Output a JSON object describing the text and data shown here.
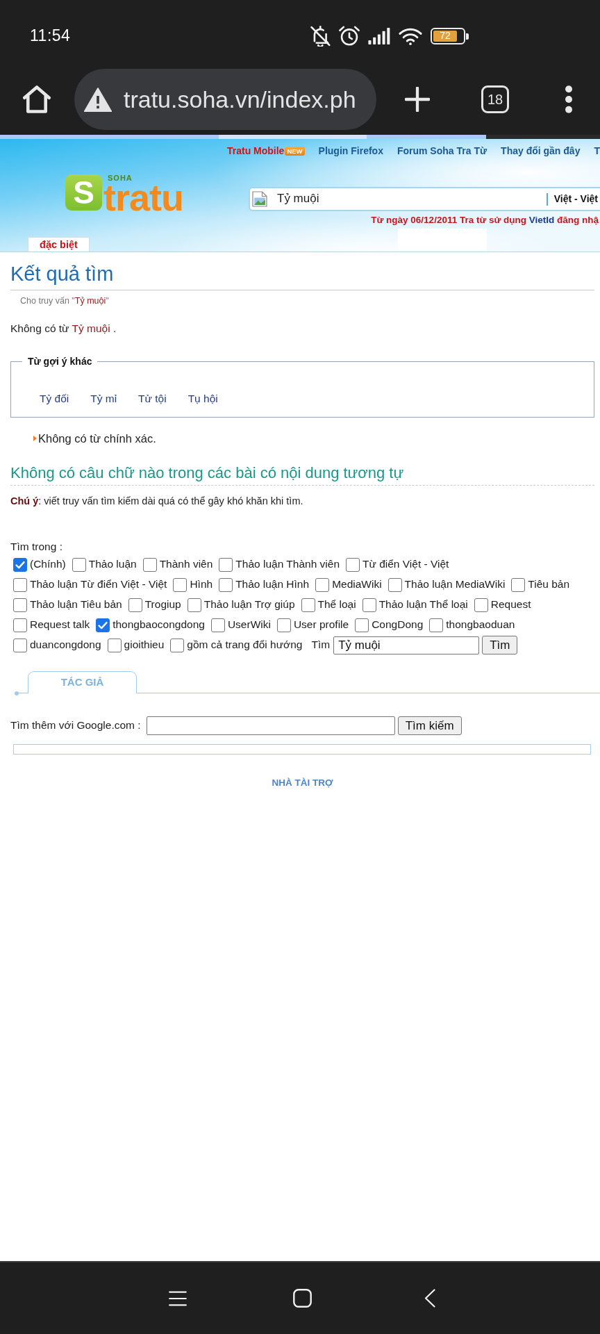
{
  "status_bar": {
    "time": "11:54",
    "battery": "72"
  },
  "browser": {
    "url": "tratu.soha.vn/index.ph",
    "tab_count": "18",
    "progress": {
      "level": 0.81
    }
  },
  "site_header": {
    "top_links": [
      {
        "label": "Tratu Mobile",
        "kind": "featured",
        "badge": "NEW"
      },
      {
        "label": "Plugin Firefox",
        "kind": "plain"
      },
      {
        "label": "Forum Soha Tra Từ",
        "kind": "plain"
      },
      {
        "label": "Thay đổi gần đây",
        "kind": "plain"
      },
      {
        "label": "T",
        "kind": "plain"
      }
    ],
    "logo": {
      "brand": "SOHA",
      "initial": "S",
      "name": "tratu"
    },
    "search": {
      "value": "Tỷ muội",
      "dictionary": "Việt - Việt"
    },
    "notice": {
      "text": "Từ ngày 06/12/2011 Tra từ sử dụng",
      "link": "VietId",
      "after": "đăng nhậ"
    },
    "tabs": [
      {
        "label": "đặc biệt",
        "selected": true
      }
    ]
  },
  "results": {
    "title": "Kết quả tìm",
    "query_line": {
      "prefix": "Cho truy vấn \"",
      "term": "Tỷ muội",
      "suffix": "\""
    },
    "no_match": {
      "prefix": "Không có từ",
      "term": "Tỷ muội",
      "suffix": "."
    },
    "suggestions": {
      "legend": "Từ gợi ý khác",
      "items": [
        "Tỷ đối",
        "Tỷ mỉ",
        "Tử tội",
        "Tụ hội"
      ]
    },
    "exact_note": "Không có từ chính xác.",
    "fulltext_heading": "Không có câu chữ nào trong các bài có nội dung tương tự",
    "tip": "**Chú ý**: viết truy vấn tìm kiếm dài quá có thể gây khó khăn khi tìm."
  },
  "search_form": {
    "label": "Tìm trong :",
    "namespaces": [
      {
        "label": "(Chính)",
        "checked": true
      },
      {
        "label": "Thảo luận",
        "checked": false
      },
      {
        "label": "Thành viên",
        "checked": false
      },
      {
        "label": "Thảo luận Thành viên",
        "checked": false
      },
      {
        "label": "Từ điển Việt - Việt",
        "checked": false
      },
      {
        "label": "Thảo luận Từ điển Việt - Việt",
        "checked": false
      },
      {
        "label": "Hình",
        "checked": false
      },
      {
        "label": "Thảo luận Hình",
        "checked": false
      },
      {
        "label": "MediaWiki",
        "checked": false
      },
      {
        "label": "Thảo luận MediaWiki",
        "checked": false
      },
      {
        "label": "Tiêu bản",
        "checked": false
      },
      {
        "label": "Thảo luận Tiêu bản",
        "checked": false
      },
      {
        "label": "Trogiup",
        "checked": false
      },
      {
        "label": "Thảo luận Trợ giúp",
        "checked": false
      },
      {
        "label": "Thể loại",
        "checked": false
      },
      {
        "label": "Thảo luận Thể loại",
        "checked": false
      },
      {
        "label": "Request",
        "checked": false
      },
      {
        "label": "Request talk",
        "checked": false
      },
      {
        "label": "thongbaocongdong",
        "checked": true
      },
      {
        "label": "UserWiki",
        "checked": false
      },
      {
        "label": "User profile",
        "checked": false
      },
      {
        "label": "CongDong",
        "checked": false
      },
      {
        "label": "thongbaoduan",
        "checked": false
      },
      {
        "label": "duancongdong",
        "checked": false
      },
      {
        "label": "gioithieu",
        "checked": false
      }
    ],
    "redirects": {
      "label": "gồm cả trang đổi hướng",
      "checked": false
    },
    "query_label": "Tìm",
    "query": "Tỷ muội",
    "button": "Tìm"
  },
  "author_tab": {
    "label": "TÁC GIẢ"
  },
  "google_search": {
    "label": "Tìm thêm với Google.com :",
    "button": "Tìm kiếm"
  },
  "sponsor": {
    "title": "NHÀ TÀI TRỢ"
  }
}
